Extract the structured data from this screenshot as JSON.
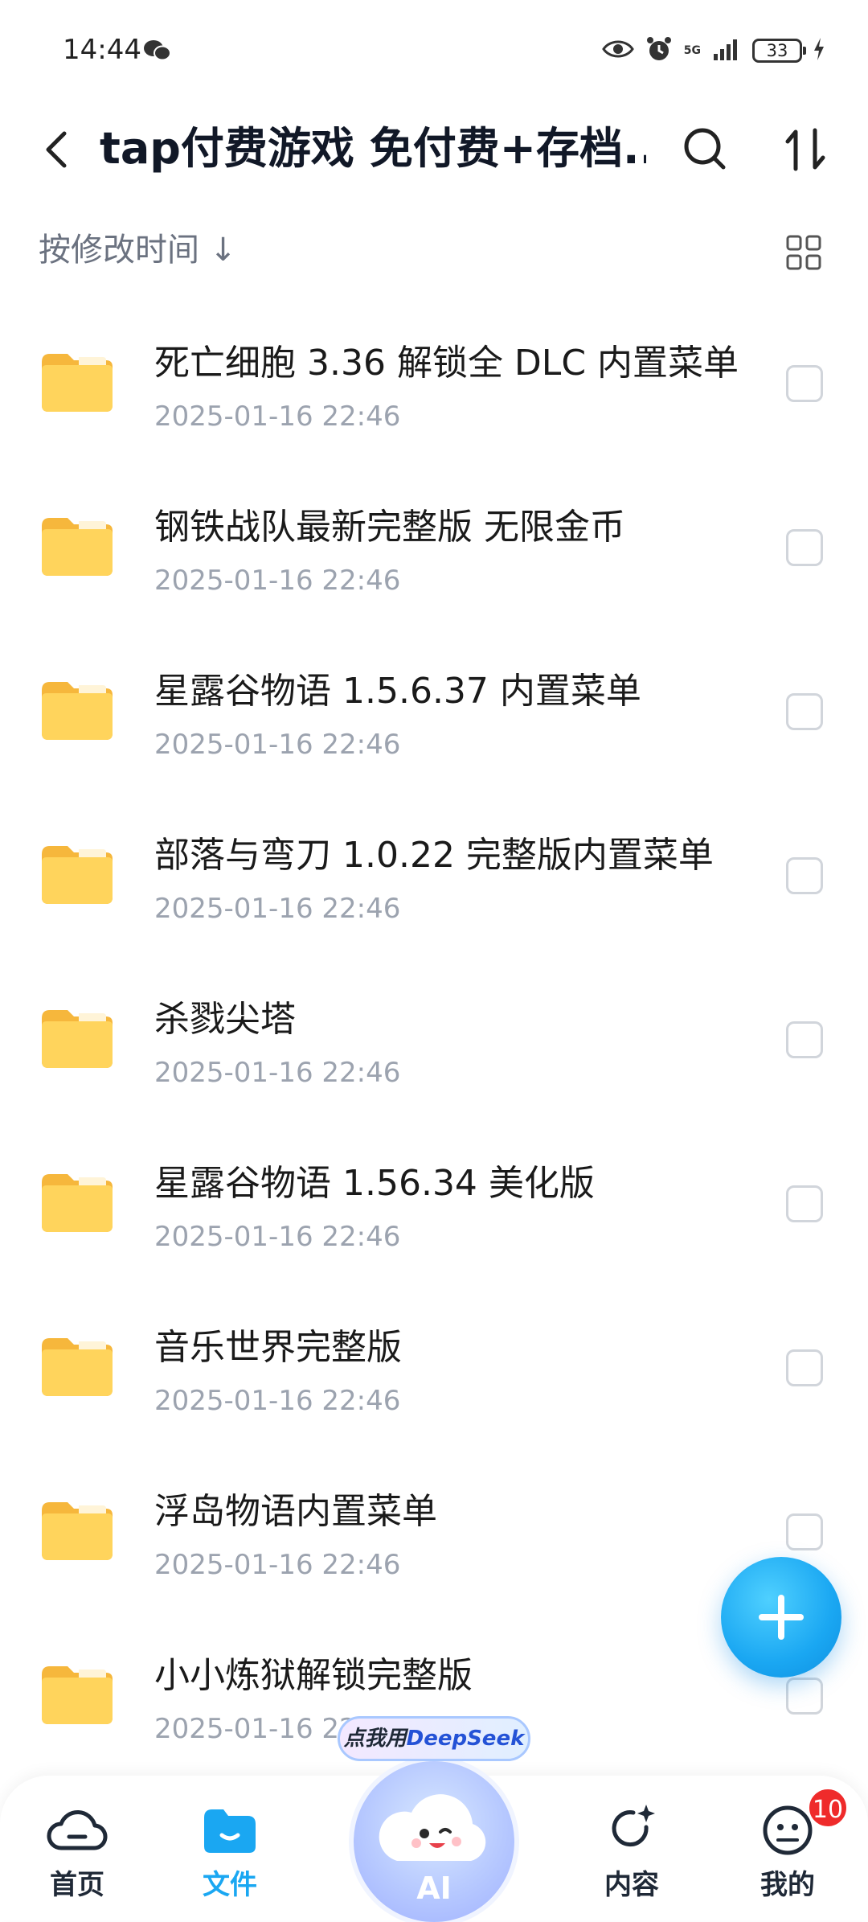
{
  "status_bar": {
    "time": "14:44",
    "battery": "33",
    "network": "5G"
  },
  "header": {
    "title": "tap付费游戏 免付费+存档..."
  },
  "sort": {
    "label": "按修改时间 ↓"
  },
  "files": [
    {
      "name": "死亡细胞 3.36 解锁全 DLC 内置菜单",
      "date": "2025-01-16 22:46"
    },
    {
      "name": "钢铁战队最新完整版  无限金币",
      "date": "2025-01-16 22:46"
    },
    {
      "name": "星露谷物语 1.5.6.37 内置菜单",
      "date": "2025-01-16 22:46"
    },
    {
      "name": "部落与弯刀 1.0.22 完整版内置菜单",
      "date": "2025-01-16 22:46"
    },
    {
      "name": "杀戮尖塔",
      "date": "2025-01-16 22:46"
    },
    {
      "name": "星露谷物语 1.56.34 美化版",
      "date": "2025-01-16 22:46"
    },
    {
      "name": "音乐世界完整版",
      "date": "2025-01-16 22:46"
    },
    {
      "name": "浮岛物语内置菜单",
      "date": "2025-01-16 22:46"
    },
    {
      "name": "小小炼狱解锁完整版",
      "date": "2025-01-16 22:46"
    }
  ],
  "ai": {
    "pill_prefix": "点我用",
    "pill_brand": "DeepSeek",
    "label": "AI"
  },
  "nav": {
    "home": "首页",
    "files": "文件",
    "content": "内容",
    "mine": "我的",
    "mine_badge": "10"
  },
  "colors": {
    "accent": "#1aa7f2",
    "folder": "#fbc94e",
    "badge": "#ef2b2b"
  }
}
